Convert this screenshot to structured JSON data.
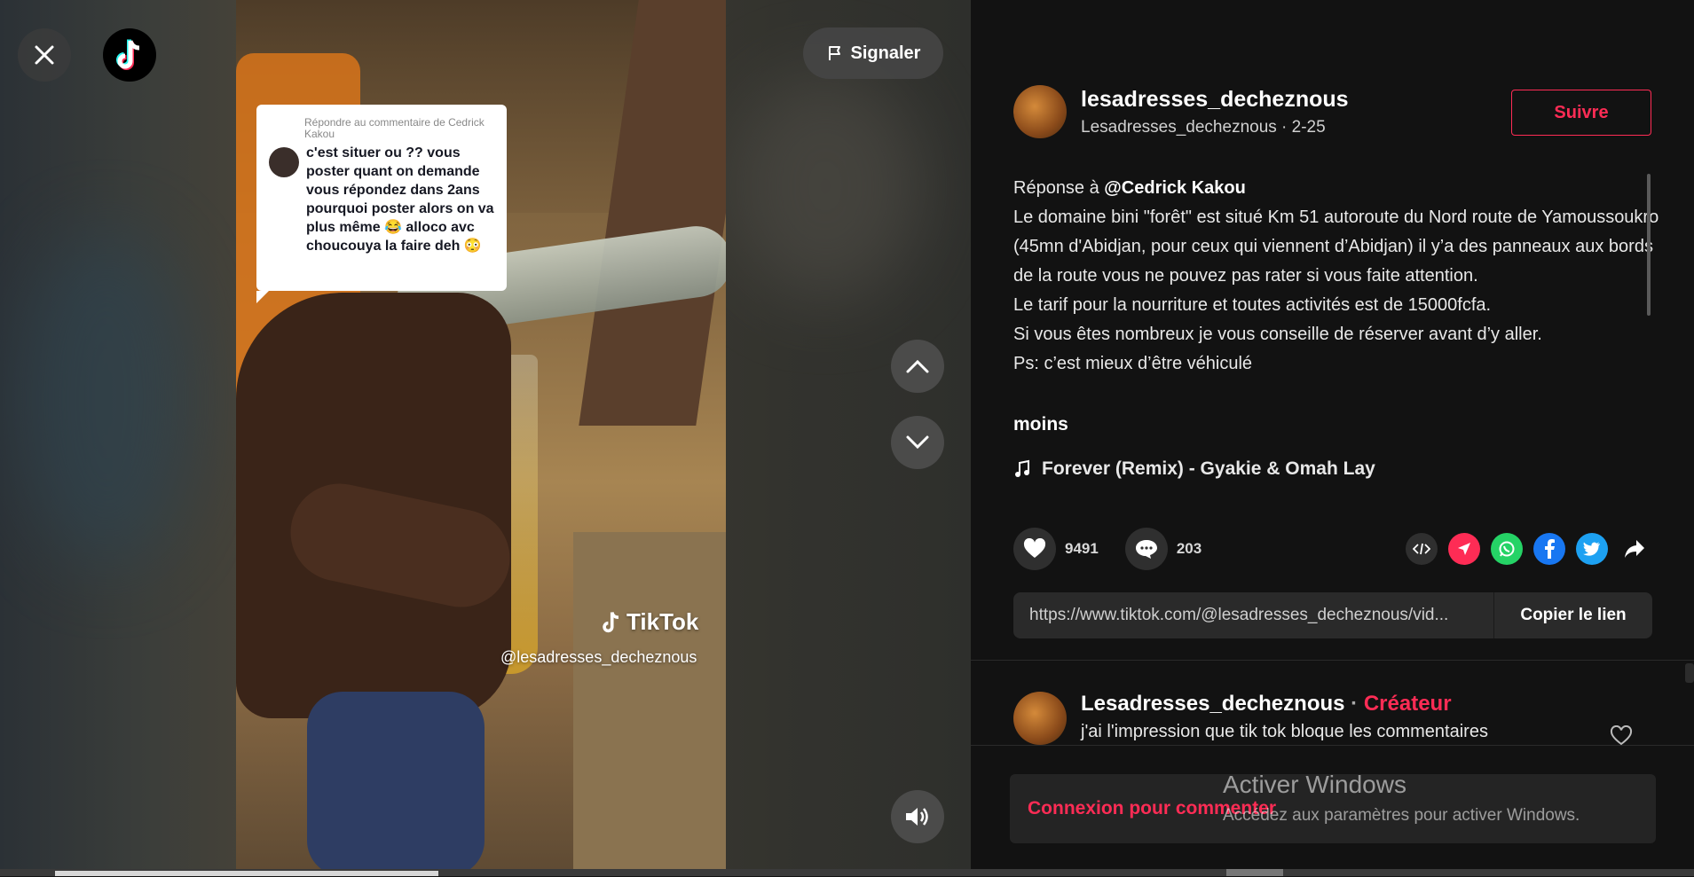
{
  "player": {
    "report_label": "Signaler",
    "reply_bubble": {
      "header": "Répondre au commentaire de Cedrick Kakou",
      "text": "c'est situer ou ?? vous poster quant on demande vous répondez dans 2ans pourquoi poster alors on va plus même 😂 alloco avc choucouya la faire deh 😳"
    },
    "watermark_brand": "TikTok",
    "watermark_user": "@lesadresses_decheznous"
  },
  "post": {
    "username": "lesadresses_decheznous",
    "meta": "Lesadresses_decheznous · 2-25",
    "follow_label": "Suivre",
    "reply_prefix": "Réponse à ",
    "reply_mention": "@Cedrick Kakou",
    "description_lines": [
      "Le domaine bini \"forêt\" est situé Km 51 autoroute du Nord route de Yamoussoukro (45mn d'Abidjan, pour ceux qui viennent d’Abidjan) il y’a des panneaux aux bords de la route vous ne pouvez pas rater si vous faite attention.",
      "Le tarif pour la nourriture et toutes activités est de 15000fcfa.",
      "Si vous êtes nombreux je vous conseille de réserver avant d’y aller.",
      "Ps: c’est mieux d’être véhiculé"
    ],
    "less_label": "moins",
    "music": "Forever (Remix) - Gyakie & Omah Lay",
    "likes": "9491",
    "comments": "203",
    "link": "https://www.tiktok.com/@lesadresses_decheznous/vid...",
    "copy_label": "Copier le lien"
  },
  "comments": [
    {
      "author": "Lesadresses_decheznous",
      "separator": "·",
      "badge": "Créateur",
      "text": "j'ai l'impression que tik tok bloque les commentaires"
    }
  ],
  "comment_login_label": "Connexion pour commenter",
  "windows_activation": {
    "title": "Activer Windows",
    "subtitle": "Accédez aux paramètres pour activer Windows."
  },
  "colors": {
    "accent": "#fe2c55",
    "panel_bg": "#121212"
  },
  "icons": [
    "close-icon",
    "tiktok-logo-icon",
    "flag-icon",
    "chevron-up-icon",
    "chevron-down-icon",
    "speaker-icon",
    "music-note-icon",
    "heart-icon",
    "comment-icon",
    "embed-icon",
    "send-icon",
    "whatsapp-icon",
    "facebook-icon",
    "twitter-icon",
    "share-icon"
  ]
}
